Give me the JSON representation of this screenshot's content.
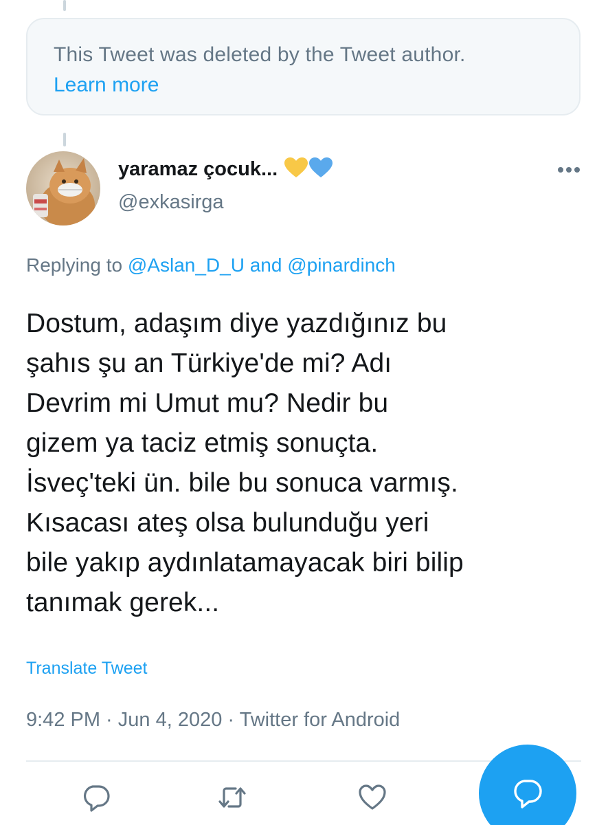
{
  "deleted_notice": {
    "text": "This Tweet was deleted by the Tweet author.",
    "learn_more": "Learn more"
  },
  "author": {
    "name": "yaramaz çocuk...",
    "handle": "@exkasirga",
    "badges": [
      "yellow-heart-icon",
      "blue-heart-icon"
    ]
  },
  "replying": {
    "prefix": "Replying to",
    "mention1": "@Aslan_D_U",
    "conjunction": "and",
    "mention2": "@pinardinch"
  },
  "tweet": {
    "text": "Dostum, adaşım diye yazdığınız bu\nşahıs şu an Türkiye'de mi? Adı\nDevrim mi Umut mu? Nedir bu\ngizem ya  taciz etmiş sonuçta.\nİsveç'teki ün. bile bu sonuca varmış.\nKısacası ateş olsa bulunduğu yeri\nbile yakıp aydınlatamayacak biri bilip\ntanımak gerek...",
    "translate_label": "Translate Tweet",
    "timestamp": "9:42 PM · Jun 4, 2020 · Twitter for Android"
  },
  "actions": [
    "reply-icon",
    "retweet-icon",
    "like-icon"
  ],
  "fab_icon": "compose-reply-icon",
  "colors": {
    "accent": "#1da1f2",
    "secondary_text": "#657786",
    "primary_text": "#14171a",
    "deleted_bg": "#f5f8fa",
    "border": "#e6ecf0"
  }
}
